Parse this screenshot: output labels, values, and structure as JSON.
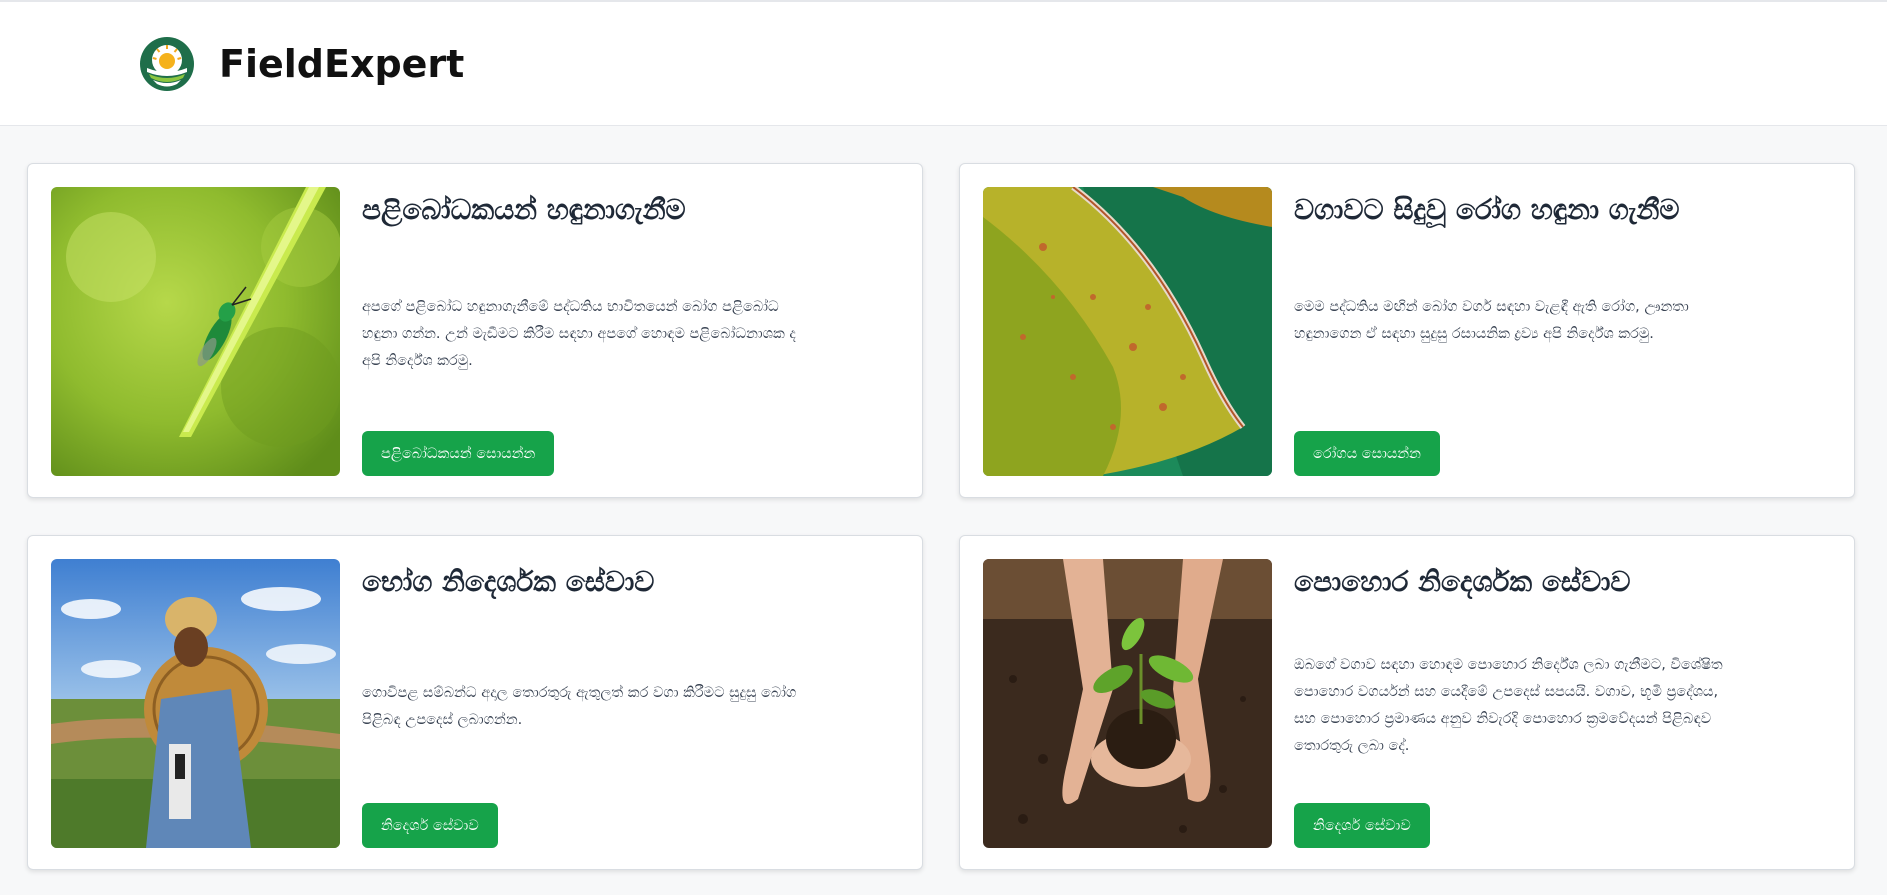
{
  "header": {
    "brand": "FieldExpert",
    "logo_icon": "sun-over-field-logo",
    "accent_color": "#16a34a"
  },
  "cards": [
    {
      "title": "පළිබෝධකයන් හඳුනාගැනීම",
      "description": "අපගේ පළිබෝධ හඳුනාගැනීමේ පද්ධතිය භාවිතයෙන් බෝග පළිබෝධ හඳුනා ගන්න. උන් මැඩීමට කිරීම සඳහා අපගේ හොඳම පළිබෝධනාශක ද අපි නිර්දේශ කරමු.",
      "button": "පළිබෝධකයන් සොයන්න",
      "image": "insect-on-leaf-image"
    },
    {
      "title": "වගාවට සිදුවූ රෝග හඳුනා ගැනීම",
      "description": "මෙම පද්ධතිය මඟින් බෝග වගර් සඳහා වැළඳී ඇති රෝග, ඌනතා හඳුනාගෙන ඒ සඳහා සුදුසු රසායනික ද්‍රව්‍ය අපි නිර්දේශ කරමු.",
      "button": "රෝගය සොයන්න",
      "image": "diseased-leaf-image"
    },
    {
      "title": "භෝග නිදෙර්ශක සේවාව",
      "description": "ගොවිපළ සම්බන්ධ අදාල තොරතුරු ඇතුලත් කර වගා කිරීමට සුදුසු බෝග පිළිබඳ උපදෙස් ලබාගන්න.",
      "button": "නිදෙර්ශ සේවාව",
      "image": "farmer-image"
    },
    {
      "title": "පොහොර නිදෙර්ශක සේවාව",
      "description": "ඔබගේ වගාව සඳහා හොඳම පොහොර නිර්දේශ ලබා ගැනීමට, විශේෂිත පොහොර වගර්යන් සහ යෙදීමේ උපදෙස් සපයයි. වගාව, භූමි ප්‍රදේශය, සහ පොහොර ප්‍රමාණය අනුව නිවැරදි පොහොර ක්‍රමවේදයන් පිළිබඳව තොරතුරු ලබා දේ.",
      "button": "නිදෙර්ශ සේවාව",
      "image": "seedling-in-hands-image"
    }
  ]
}
